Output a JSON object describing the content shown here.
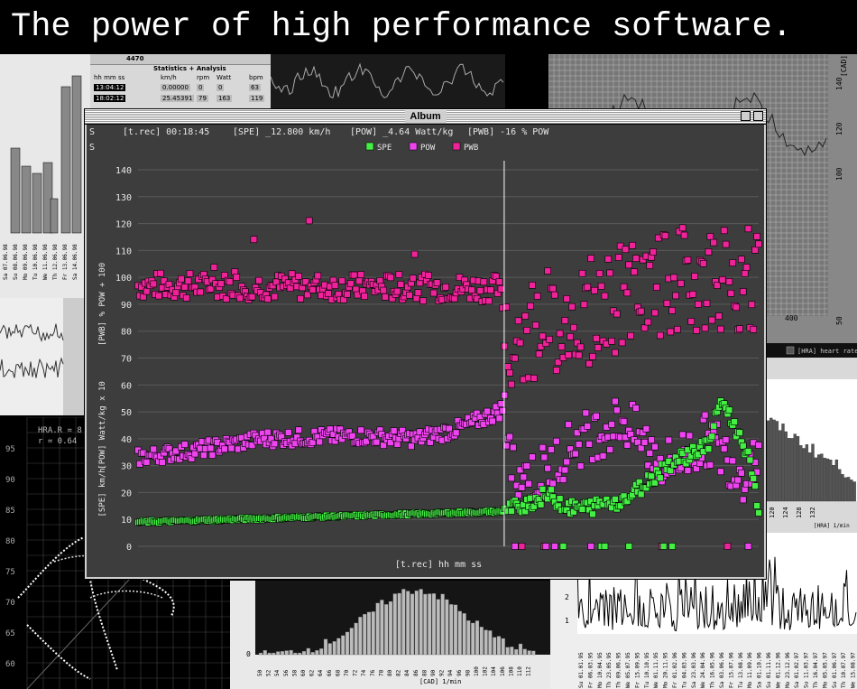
{
  "banner": {
    "text": "The power of high performance software."
  },
  "window": {
    "title": "Album",
    "header": {
      "s1": "S",
      "s2": "S",
      "trec": "[t.rec] 00:18:45",
      "spe": "[SPE] _12.800 km/h",
      "pow": "[POW] _4.64 Watt/kg",
      "pwb": "[PWB] -16 % POW"
    }
  },
  "chart_data": {
    "type": "scatter",
    "title": "",
    "xlabel": "[t.rec] hh mm ss",
    "ylabels": [
      "[SPE] km/h",
      "[POW] Watt/kg x 10",
      "[PWB] % POW + 100"
    ],
    "yticks": [
      "0",
      "10",
      "20",
      "30",
      "40",
      "50",
      "60",
      "70",
      "80",
      "90",
      "100",
      "110",
      "120",
      "130",
      "140"
    ],
    "ylim": [
      0,
      140
    ],
    "grid": true,
    "legend": {
      "placement": "top-center",
      "entries": [
        {
          "name": "SPE",
          "color": "#44ee44"
        },
        {
          "name": "POW",
          "color": "#ee44ee"
        },
        {
          "name": "PWB",
          "color": "#ee2299"
        }
      ]
    },
    "cursor_fraction": 0.59,
    "series": [
      {
        "name": "SPE",
        "color": "#44ee44",
        "trend_segments": [
          [
            0.0,
            9
          ],
          [
            0.59,
            13
          ],
          [
            0.66,
            19
          ],
          [
            0.7,
            14
          ],
          [
            0.74,
            15
          ],
          [
            0.79,
            18
          ],
          [
            0.85,
            30
          ],
          [
            0.92,
            38
          ],
          [
            0.94,
            55
          ],
          [
            0.96,
            45
          ],
          [
            0.98,
            36
          ],
          [
            1.0,
            14
          ]
        ]
      },
      {
        "name": "POW",
        "color": "#ee44ee",
        "trend_segments": [
          [
            0.0,
            33
          ],
          [
            0.1,
            36
          ],
          [
            0.2,
            40
          ],
          [
            0.35,
            41
          ],
          [
            0.45,
            40
          ],
          [
            0.52,
            44
          ],
          [
            0.58,
            50
          ],
          [
            0.59,
            52
          ],
          [
            0.6,
            30
          ],
          [
            0.64,
            25
          ],
          [
            0.7,
            38
          ],
          [
            0.78,
            47
          ],
          [
            0.85,
            30
          ],
          [
            0.92,
            40
          ],
          [
            0.98,
            26
          ],
          [
            1.0,
            38
          ]
        ]
      },
      {
        "name": "PWB",
        "color": "#ee2299",
        "trend_segments": [
          [
            0.0,
            97
          ],
          [
            0.58,
            96
          ],
          [
            0.6,
            80
          ],
          [
            0.7,
            85
          ],
          [
            0.8,
            95
          ],
          [
            0.9,
            100
          ],
          [
            1.0,
            100
          ]
        ]
      }
    ]
  },
  "bg": {
    "table_id": "4470",
    "table_title": "Statistics + Analysis",
    "table_cols": [
      "hh mm ss",
      "km/h",
      "rpm",
      "Watt",
      "bpm"
    ],
    "table_rows": [
      [
        "13:04:12",
        "0.00000",
        "0",
        "0",
        "63"
      ],
      [
        "18:02:12",
        "25.45391",
        "79",
        "163",
        "119"
      ]
    ],
    "bars1_labels": [
      "Sa 07.06.98",
      "Su 08.06.98",
      "Mo 09.06.98",
      "Tu 10.06.98",
      "We 11.06.98",
      "Th 12.06.98",
      "Fr 13.06.98",
      "Sa 14.06.98"
    ],
    "hra_label": "[HRA] heart rate",
    "hra_axis": "[HRA] 1/min",
    "hra_ticks": [
      "120",
      "124",
      "128",
      "132"
    ],
    "grid_axis": "[CAD] 1/min",
    "grid_ticks": [
      "100",
      "120",
      "140"
    ],
    "grid_bottom": [
      "400",
      "50"
    ],
    "scatter_stat1": "HRA.R = 8",
    "scatter_stat2": "r = 0.64",
    "scatter_ticks": [
      "95",
      "90",
      "85",
      "80",
      "75",
      "70",
      "65",
      "60"
    ],
    "hist_axis": "[CAD] 1/min",
    "hist_zero": "0",
    "hist_ticks": [
      "50",
      "52",
      "54",
      "56",
      "58",
      "60",
      "62",
      "64",
      "66",
      "68",
      "70",
      "72",
      "74",
      "76",
      "78",
      "80",
      "82",
      "84",
      "86",
      "88",
      "90",
      "92",
      "94",
      "96",
      "98",
      "100",
      "102",
      "104",
      "106",
      "108",
      "110",
      "112"
    ],
    "spiky_ticks": [
      "2",
      "1"
    ],
    "spiky_labels": [
      "Su 01.01.95",
      "Fr 06.03.95",
      "Mo 10.04.95",
      "Th 23.05.95",
      "Th 09.06.95",
      "We 05.07.95",
      "Fr 15.09.95",
      "Tu 10.10.95",
      "We 01.11.95",
      "Mo 20.11.95",
      "Fr 01.02.96",
      "Tu 04.03.96",
      "Sa 23.03.96",
      "We 24.04.96",
      "Th 16.05.96",
      "Sa 03.06.96",
      "Fr 15.07.96",
      "Tu 13.08.96",
      "Mo 11.09.96",
      "Sa 01.10.96",
      "Su 01.11.96",
      "We 01.12.96",
      "Mo 23.12.96",
      "Sa 01.02.97",
      "Su 11.03.97",
      "Th 16.04.97",
      "Mo 05.05.97",
      "Su 01.06.97",
      "Th 10.07.97",
      "We 15.08.97"
    ]
  }
}
